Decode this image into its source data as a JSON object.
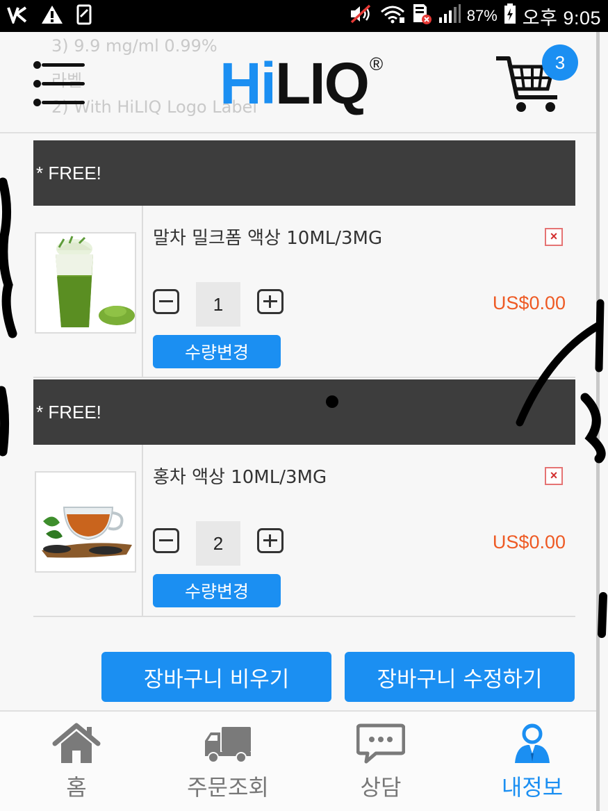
{
  "status_bar": {
    "battery": "87%",
    "time": "오후 9:05"
  },
  "header": {
    "logo_hi": "Hi",
    "logo_liq": "LIQ",
    "logo_reg": "®",
    "cart_count": "3",
    "ghost_lines": [
      "3) 9.9 mg/ml 0.99%",
      "라벨",
      "2) With HiLIQ Logo Label"
    ]
  },
  "cart": {
    "items": [
      {
        "free_label": "* FREE!",
        "name": "말차 밀크폼 액상 10ML/3MG",
        "quantity": "1",
        "price": "US$0.00",
        "change_label": "수량변경",
        "delete_label": "×",
        "image": "matcha-drink"
      },
      {
        "free_label": "* FREE!",
        "name": "홍차 액상 10ML/3MG",
        "quantity": "2",
        "price": "US$0.00",
        "change_label": "수량변경",
        "delete_label": "×",
        "image": "black-tea-cup"
      }
    ]
  },
  "actions": {
    "empty_cart": "장바구니 비우기",
    "edit_cart": "장바구니 수정하기"
  },
  "bottom_nav": {
    "items": [
      {
        "label": "홈",
        "icon": "home-icon"
      },
      {
        "label": "주문조회",
        "icon": "truck-icon"
      },
      {
        "label": "상담",
        "icon": "chat-icon"
      },
      {
        "label": "내정보",
        "icon": "user-icon",
        "active": true
      }
    ]
  },
  "colors": {
    "accent": "#1b8ff2",
    "price": "#ee5a24",
    "free_bar": "#3d3d3d"
  }
}
